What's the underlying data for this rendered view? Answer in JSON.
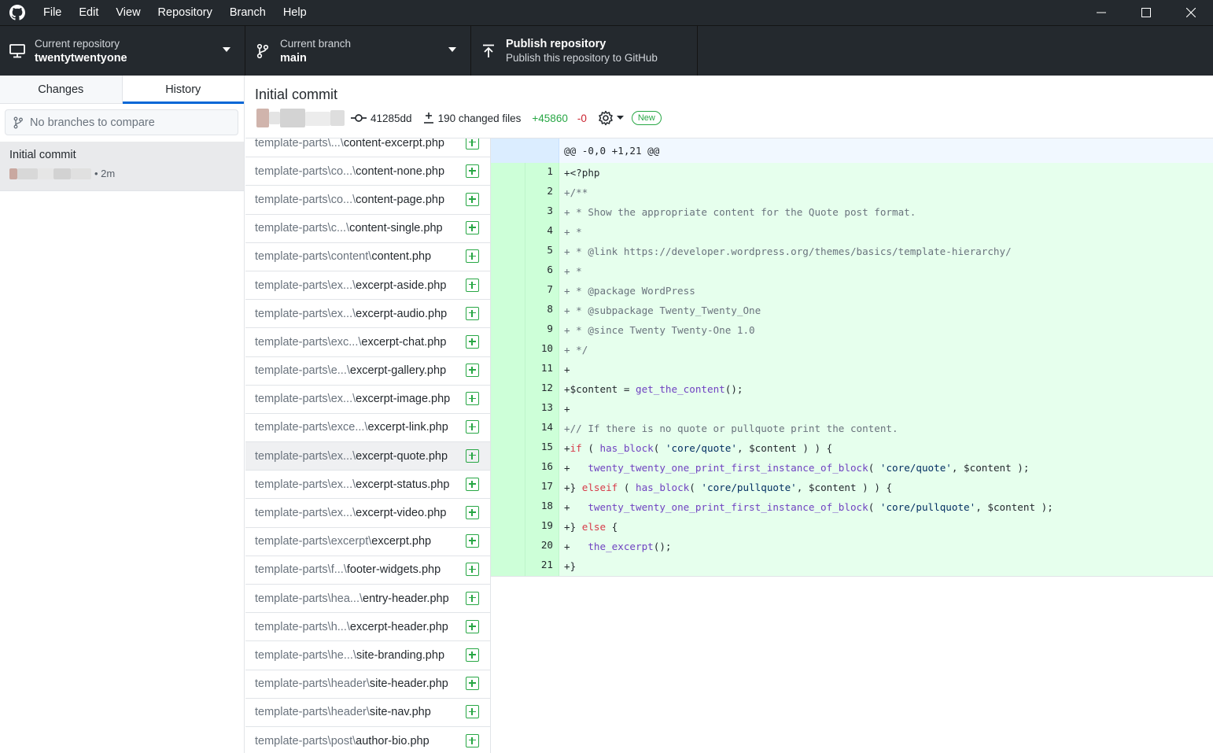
{
  "menu": [
    "File",
    "Edit",
    "View",
    "Repository",
    "Branch",
    "Help"
  ],
  "toolbar": {
    "repo_label": "Current repository",
    "repo_name": "twentytwentyone",
    "branch_label": "Current branch",
    "branch_name": "main",
    "publish_title": "Publish repository",
    "publish_sub": "Publish this repository to GitHub"
  },
  "sidebar": {
    "tabs": [
      "Changes",
      "History"
    ],
    "active_tab": "History",
    "compare_placeholder": "No branches to compare",
    "commit": {
      "title": "Initial commit",
      "time": "• 2m"
    }
  },
  "commit": {
    "title": "Initial commit",
    "sha": "41285dd",
    "changed_files": "190 changed files",
    "additions": "+45860",
    "deletions": "-0",
    "badge": "New"
  },
  "files": [
    {
      "dir": "template-parts\\...\\",
      "name": "content-excerpt.php"
    },
    {
      "dir": "template-parts\\co...\\",
      "name": "content-none.php"
    },
    {
      "dir": "template-parts\\co...\\",
      "name": "content-page.php"
    },
    {
      "dir": "template-parts\\c...\\",
      "name": "content-single.php"
    },
    {
      "dir": "template-parts\\content\\",
      "name": "content.php"
    },
    {
      "dir": "template-parts\\ex...\\",
      "name": "excerpt-aside.php"
    },
    {
      "dir": "template-parts\\ex...\\",
      "name": "excerpt-audio.php"
    },
    {
      "dir": "template-parts\\exc...\\",
      "name": "excerpt-chat.php"
    },
    {
      "dir": "template-parts\\e...\\",
      "name": "excerpt-gallery.php"
    },
    {
      "dir": "template-parts\\ex...\\",
      "name": "excerpt-image.php"
    },
    {
      "dir": "template-parts\\exce...\\",
      "name": "excerpt-link.php"
    },
    {
      "dir": "template-parts\\ex...\\",
      "name": "excerpt-quote.php",
      "selected": true
    },
    {
      "dir": "template-parts\\ex...\\",
      "name": "excerpt-status.php"
    },
    {
      "dir": "template-parts\\ex...\\",
      "name": "excerpt-video.php"
    },
    {
      "dir": "template-parts\\excerpt\\",
      "name": "excerpt.php"
    },
    {
      "dir": "template-parts\\f...\\",
      "name": "footer-widgets.php"
    },
    {
      "dir": "template-parts\\hea...\\",
      "name": "entry-header.php"
    },
    {
      "dir": "template-parts\\h...\\",
      "name": "excerpt-header.php"
    },
    {
      "dir": "template-parts\\he...\\",
      "name": "site-branding.php"
    },
    {
      "dir": "template-parts\\header\\",
      "name": "site-header.php"
    },
    {
      "dir": "template-parts\\header\\",
      "name": "site-nav.php"
    },
    {
      "dir": "template-parts\\post\\",
      "name": "author-bio.php"
    }
  ],
  "diff": {
    "hunk": "@@ -0,0 +1,21 @@",
    "lines": [
      [
        [
          "+<?php",
          ""
        ]
      ],
      [
        [
          "+/**",
          "cm"
        ]
      ],
      [
        [
          "+ * Show the appropriate content for the Quote post format.",
          "cm"
        ]
      ],
      [
        [
          "+ *",
          "cm"
        ]
      ],
      [
        [
          "+ * @link https://developer.wordpress.org/themes/basics/template-hierarchy/",
          "cm"
        ]
      ],
      [
        [
          "+ *",
          "cm"
        ]
      ],
      [
        [
          "+ * @package WordPress",
          "cm"
        ]
      ],
      [
        [
          "+ * @subpackage Twenty_Twenty_One",
          "cm"
        ]
      ],
      [
        [
          "+ * @since Twenty Twenty-One 1.0",
          "cm"
        ]
      ],
      [
        [
          "+ */",
          "cm"
        ]
      ],
      [
        [
          "+",
          ""
        ]
      ],
      [
        [
          "+$content = ",
          ""
        ],
        [
          "get_the_content",
          "fn"
        ],
        [
          "();",
          ""
        ]
      ],
      [
        [
          "+",
          ""
        ]
      ],
      [
        [
          "+// If there is no quote or pullquote print the content.",
          "cm"
        ]
      ],
      [
        [
          "+",
          ""
        ],
        [
          "if",
          "kw"
        ],
        [
          " ( ",
          ""
        ],
        [
          "has_block",
          "fn"
        ],
        [
          "( ",
          ""
        ],
        [
          "'core/quote'",
          "str"
        ],
        [
          ", $content ) ) {",
          ""
        ]
      ],
      [
        [
          "+   ",
          ""
        ],
        [
          "twenty_twenty_one_print_first_instance_of_block",
          "fn"
        ],
        [
          "( ",
          ""
        ],
        [
          "'core/quote'",
          "str"
        ],
        [
          ", $content );",
          ""
        ]
      ],
      [
        [
          "+} ",
          ""
        ],
        [
          "elseif",
          "kw"
        ],
        [
          " ( ",
          ""
        ],
        [
          "has_block",
          "fn"
        ],
        [
          "( ",
          ""
        ],
        [
          "'core/pullquote'",
          "str"
        ],
        [
          ", $content ) ) {",
          ""
        ]
      ],
      [
        [
          "+   ",
          ""
        ],
        [
          "twenty_twenty_one_print_first_instance_of_block",
          "fn"
        ],
        [
          "( ",
          ""
        ],
        [
          "'core/pullquote'",
          "str"
        ],
        [
          ", $content );",
          ""
        ]
      ],
      [
        [
          "+} ",
          ""
        ],
        [
          "else",
          "kw"
        ],
        [
          " {",
          ""
        ]
      ],
      [
        [
          "+   ",
          ""
        ],
        [
          "the_excerpt",
          "fn"
        ],
        [
          "();",
          ""
        ]
      ],
      [
        [
          "+}",
          ""
        ]
      ]
    ]
  },
  "colors": {
    "comment": "#6a737d",
    "function": "#6f42c1",
    "keyword": "#d73a49",
    "string": "#032f62",
    "added_bg": "#e6ffed",
    "accent": "#0366d6"
  }
}
